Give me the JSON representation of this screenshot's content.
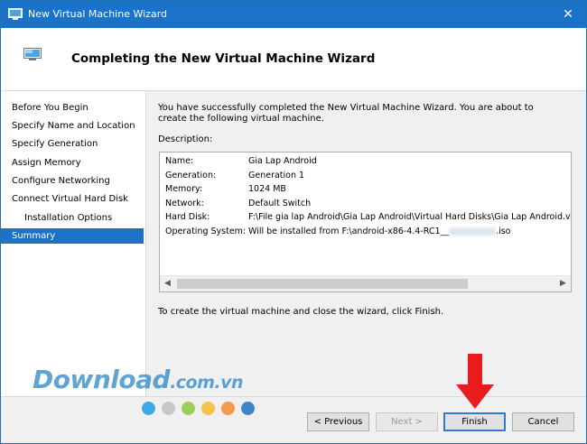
{
  "window": {
    "title": "New Virtual Machine Wizard",
    "close_glyph": "✕"
  },
  "header": {
    "title": "Completing the New Virtual Machine Wizard"
  },
  "nav": {
    "items": [
      {
        "label": "Before You Begin"
      },
      {
        "label": "Specify Name and Location"
      },
      {
        "label": "Specify Generation"
      },
      {
        "label": "Assign Memory"
      },
      {
        "label": "Configure Networking"
      },
      {
        "label": "Connect Virtual Hard Disk"
      },
      {
        "label": "Installation Options"
      },
      {
        "label": "Summary"
      }
    ],
    "selected": "Summary"
  },
  "main": {
    "intro": "You have successfully completed the New Virtual Machine Wizard. You are about to create the following virtual machine.",
    "description_label": "Description:",
    "summary_rows": [
      {
        "key": "Name:",
        "value": "Gia Lap Android"
      },
      {
        "key": "Generation:",
        "value": "Generation 1"
      },
      {
        "key": "Memory:",
        "value": "1024 MB"
      },
      {
        "key": "Network:",
        "value": "Default Switch"
      },
      {
        "key": "Hard Disk:",
        "value": "F:\\File gia lap Android\\Gia Lap Android\\Virtual Hard Disks\\Gia Lap Android.vhdx (V"
      },
      {
        "key": "Operating System:",
        "value": "Will be installed from F:\\android-x86-4.4-RC1__",
        "value_suffix": ".iso"
      }
    ],
    "closing": "To create the virtual machine and close the wizard, click Finish."
  },
  "footer": {
    "previous_label": "< Previous",
    "next_label": "Next >",
    "finish_label": "Finish",
    "cancel_label": "Cancel"
  },
  "watermark": {
    "text": "Download",
    "tld": ".com.vn"
  },
  "colors": {
    "accent": "#1a73c9",
    "annotation_arrow": "#e81c1c",
    "watermark": "#2a86c8",
    "dots": [
      "#3fa9e8",
      "#c8c8c8",
      "#9ccf5a",
      "#f7c24a",
      "#f39a4c",
      "#3f86c8"
    ]
  }
}
